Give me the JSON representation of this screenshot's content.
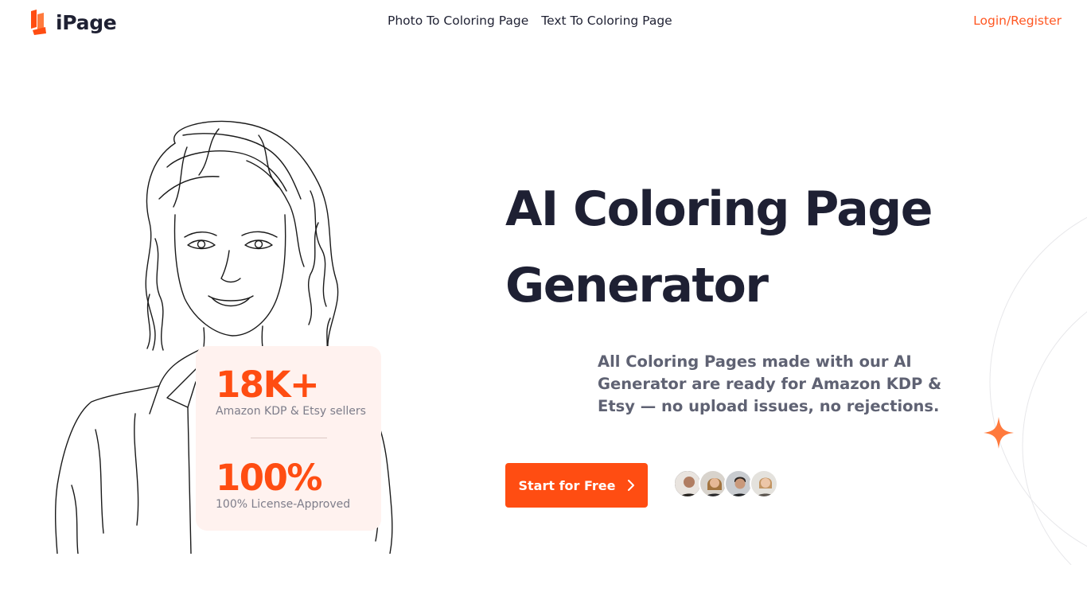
{
  "brand": {
    "name": "iPage",
    "accent": "#ff4d12"
  },
  "nav": {
    "items": [
      {
        "label": "Photo To Coloring Page"
      },
      {
        "label": "Text To Coloring Page"
      }
    ],
    "login_label": "Login/Register"
  },
  "hero": {
    "title_line1": "AI Coloring Page",
    "title_line2": "Generator",
    "subtitle": "All Coloring Pages made with our AI Generator are ready for Amazon KDP & Etsy — no upload issues, no rejections.",
    "cta_label": "Start for Free",
    "cta_icon": "chevron-right-icon"
  },
  "stats": [
    {
      "value": "18K+",
      "label": "Amazon KDP & Etsy sellers"
    },
    {
      "value": "100%",
      "label": "100% License-Approved"
    }
  ],
  "avatars": [
    {
      "name": "avatar-1"
    },
    {
      "name": "avatar-2"
    },
    {
      "name": "avatar-3"
    },
    {
      "name": "avatar-4"
    }
  ]
}
